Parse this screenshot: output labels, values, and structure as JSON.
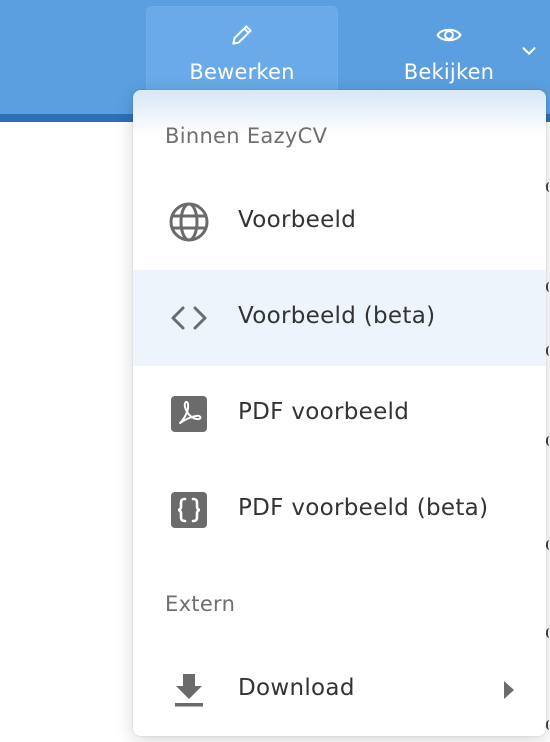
{
  "toolbar": {
    "edit_label": "Bewerken",
    "view_label": "Bekijken"
  },
  "menu": {
    "section_internal": "Binnen EazyCV",
    "section_external": "Extern",
    "items": [
      {
        "label": "Voorbeeld",
        "icon": "globe-icon"
      },
      {
        "label": "Voorbeeld (beta)",
        "icon": "code-icon"
      },
      {
        "label": "PDF voorbeeld",
        "icon": "pdf-icon"
      },
      {
        "label": "PDF voorbeeld (beta)",
        "icon": "code-braces-box-icon"
      }
    ],
    "download_label": "Download"
  },
  "colors": {
    "topbar": "#5b9fe0",
    "accent": "#2f6fb6",
    "highlight": "#eef4fb",
    "icon": "#6b6b6b"
  }
}
